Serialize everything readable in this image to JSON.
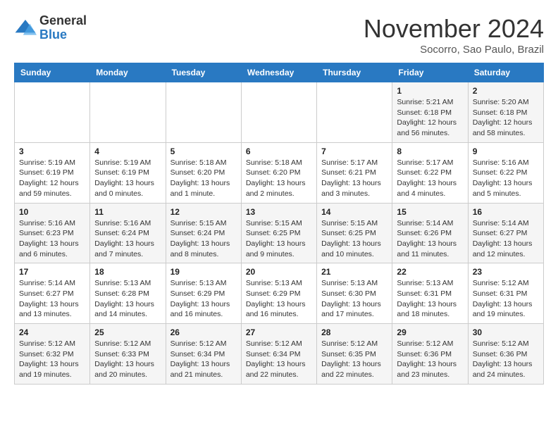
{
  "header": {
    "logo_line1": "General",
    "logo_line2": "Blue",
    "month": "November 2024",
    "location": "Socorro, Sao Paulo, Brazil"
  },
  "weekdays": [
    "Sunday",
    "Monday",
    "Tuesday",
    "Wednesday",
    "Thursday",
    "Friday",
    "Saturday"
  ],
  "weeks": [
    [
      {
        "day": "",
        "info": ""
      },
      {
        "day": "",
        "info": ""
      },
      {
        "day": "",
        "info": ""
      },
      {
        "day": "",
        "info": ""
      },
      {
        "day": "",
        "info": ""
      },
      {
        "day": "1",
        "info": "Sunrise: 5:21 AM\nSunset: 6:18 PM\nDaylight: 12 hours\nand 56 minutes."
      },
      {
        "day": "2",
        "info": "Sunrise: 5:20 AM\nSunset: 6:18 PM\nDaylight: 12 hours\nand 58 minutes."
      }
    ],
    [
      {
        "day": "3",
        "info": "Sunrise: 5:19 AM\nSunset: 6:19 PM\nDaylight: 12 hours\nand 59 minutes."
      },
      {
        "day": "4",
        "info": "Sunrise: 5:19 AM\nSunset: 6:19 PM\nDaylight: 13 hours\nand 0 minutes."
      },
      {
        "day": "5",
        "info": "Sunrise: 5:18 AM\nSunset: 6:20 PM\nDaylight: 13 hours\nand 1 minute."
      },
      {
        "day": "6",
        "info": "Sunrise: 5:18 AM\nSunset: 6:20 PM\nDaylight: 13 hours\nand 2 minutes."
      },
      {
        "day": "7",
        "info": "Sunrise: 5:17 AM\nSunset: 6:21 PM\nDaylight: 13 hours\nand 3 minutes."
      },
      {
        "day": "8",
        "info": "Sunrise: 5:17 AM\nSunset: 6:22 PM\nDaylight: 13 hours\nand 4 minutes."
      },
      {
        "day": "9",
        "info": "Sunrise: 5:16 AM\nSunset: 6:22 PM\nDaylight: 13 hours\nand 5 minutes."
      }
    ],
    [
      {
        "day": "10",
        "info": "Sunrise: 5:16 AM\nSunset: 6:23 PM\nDaylight: 13 hours\nand 6 minutes."
      },
      {
        "day": "11",
        "info": "Sunrise: 5:16 AM\nSunset: 6:24 PM\nDaylight: 13 hours\nand 7 minutes."
      },
      {
        "day": "12",
        "info": "Sunrise: 5:15 AM\nSunset: 6:24 PM\nDaylight: 13 hours\nand 8 minutes."
      },
      {
        "day": "13",
        "info": "Sunrise: 5:15 AM\nSunset: 6:25 PM\nDaylight: 13 hours\nand 9 minutes."
      },
      {
        "day": "14",
        "info": "Sunrise: 5:15 AM\nSunset: 6:25 PM\nDaylight: 13 hours\nand 10 minutes."
      },
      {
        "day": "15",
        "info": "Sunrise: 5:14 AM\nSunset: 6:26 PM\nDaylight: 13 hours\nand 11 minutes."
      },
      {
        "day": "16",
        "info": "Sunrise: 5:14 AM\nSunset: 6:27 PM\nDaylight: 13 hours\nand 12 minutes."
      }
    ],
    [
      {
        "day": "17",
        "info": "Sunrise: 5:14 AM\nSunset: 6:27 PM\nDaylight: 13 hours\nand 13 minutes."
      },
      {
        "day": "18",
        "info": "Sunrise: 5:13 AM\nSunset: 6:28 PM\nDaylight: 13 hours\nand 14 minutes."
      },
      {
        "day": "19",
        "info": "Sunrise: 5:13 AM\nSunset: 6:29 PM\nDaylight: 13 hours\nand 16 minutes."
      },
      {
        "day": "20",
        "info": "Sunrise: 5:13 AM\nSunset: 6:29 PM\nDaylight: 13 hours\nand 16 minutes."
      },
      {
        "day": "21",
        "info": "Sunrise: 5:13 AM\nSunset: 6:30 PM\nDaylight: 13 hours\nand 17 minutes."
      },
      {
        "day": "22",
        "info": "Sunrise: 5:13 AM\nSunset: 6:31 PM\nDaylight: 13 hours\nand 18 minutes."
      },
      {
        "day": "23",
        "info": "Sunrise: 5:12 AM\nSunset: 6:31 PM\nDaylight: 13 hours\nand 19 minutes."
      }
    ],
    [
      {
        "day": "24",
        "info": "Sunrise: 5:12 AM\nSunset: 6:32 PM\nDaylight: 13 hours\nand 19 minutes."
      },
      {
        "day": "25",
        "info": "Sunrise: 5:12 AM\nSunset: 6:33 PM\nDaylight: 13 hours\nand 20 minutes."
      },
      {
        "day": "26",
        "info": "Sunrise: 5:12 AM\nSunset: 6:34 PM\nDaylight: 13 hours\nand 21 minutes."
      },
      {
        "day": "27",
        "info": "Sunrise: 5:12 AM\nSunset: 6:34 PM\nDaylight: 13 hours\nand 22 minutes."
      },
      {
        "day": "28",
        "info": "Sunrise: 5:12 AM\nSunset: 6:35 PM\nDaylight: 13 hours\nand 22 minutes."
      },
      {
        "day": "29",
        "info": "Sunrise: 5:12 AM\nSunset: 6:36 PM\nDaylight: 13 hours\nand 23 minutes."
      },
      {
        "day": "30",
        "info": "Sunrise: 5:12 AM\nSunset: 6:36 PM\nDaylight: 13 hours\nand 24 minutes."
      }
    ]
  ]
}
